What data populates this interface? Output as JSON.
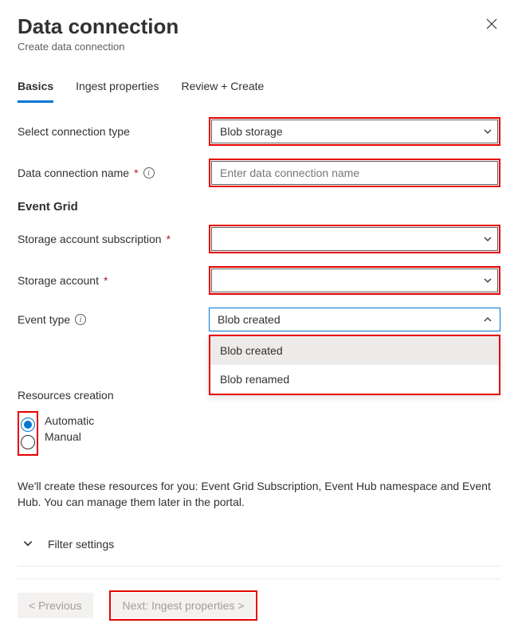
{
  "header": {
    "title": "Data connection",
    "subtitle": "Create data connection"
  },
  "tabs": {
    "basics": "Basics",
    "ingest": "Ingest properties",
    "review": "Review + Create"
  },
  "form": {
    "connection_type_label": "Select connection type",
    "connection_type_value": "Blob storage",
    "data_conn_name_label": "Data connection name",
    "data_conn_name_placeholder": "Enter data connection name",
    "event_grid_heading": "Event Grid",
    "storage_sub_label": "Storage account subscription",
    "storage_acct_label": "Storage account",
    "event_type_label": "Event type",
    "event_type_value": "Blob created",
    "event_type_options": {
      "opt0": "Blob created",
      "opt1": "Blob renamed"
    },
    "resources_creation_label": "Resources creation",
    "radio_auto": "Automatic",
    "radio_manual": "Manual",
    "help_text": "We'll create these resources for you: Event Grid Subscription, Event Hub namespace and Event Hub. You can manage them later in the portal.",
    "filter_settings": "Filter settings"
  },
  "footer": {
    "previous": "< Previous",
    "next": "Next: Ingest properties >"
  }
}
